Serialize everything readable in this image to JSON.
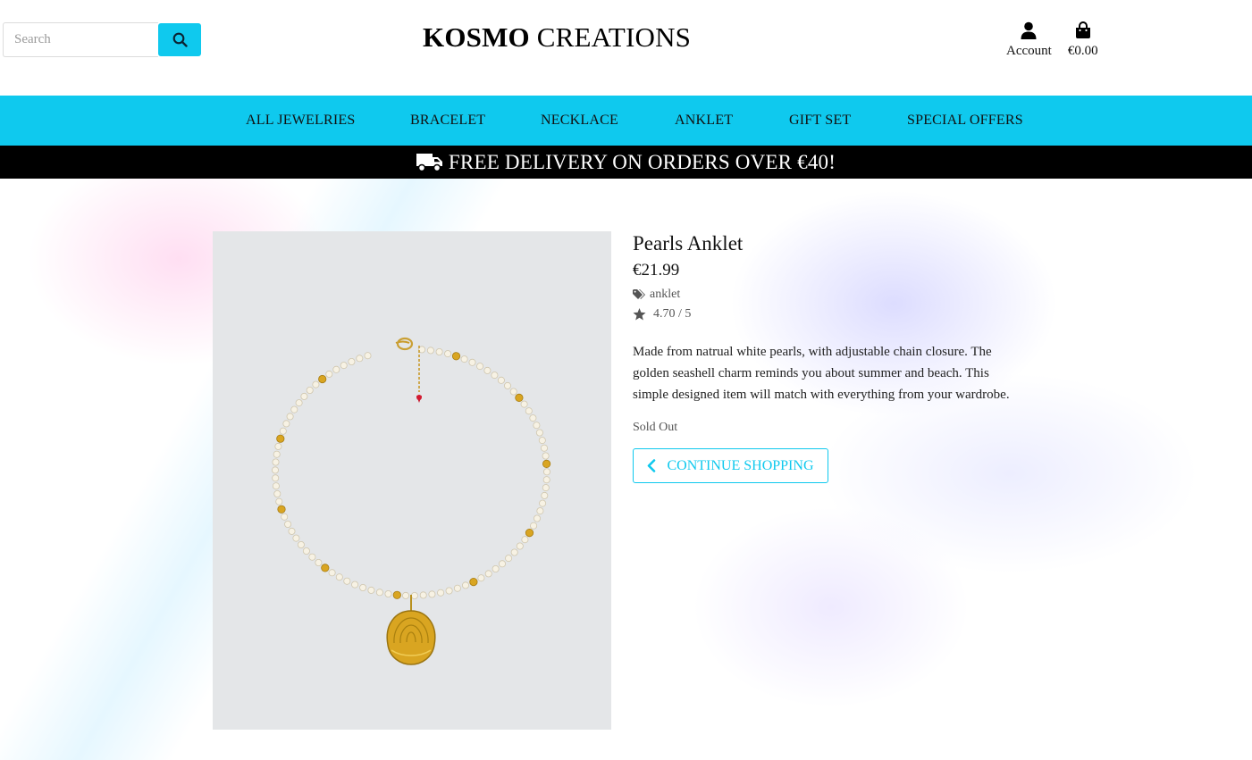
{
  "header": {
    "search_placeholder": "Search",
    "brand_bold": "KOSMO",
    "brand_rest": " CREATIONS",
    "account_label": "Account",
    "cart_total": "€0.00",
    "icons": {
      "search": "search-icon",
      "account": "user-icon",
      "cart": "shopping-bag-icon"
    }
  },
  "nav": {
    "items": [
      {
        "label": "ALL JEWELRIES"
      },
      {
        "label": "BRACELET"
      },
      {
        "label": "NECKLACE"
      },
      {
        "label": "ANKLET"
      },
      {
        "label": "GIFT SET"
      },
      {
        "label": "SPECIAL OFFERS"
      }
    ]
  },
  "banner": {
    "text": "FREE DELIVERY ON ORDERS OVER €40!",
    "icon": "truck-icon"
  },
  "product": {
    "name": "Pearls Anklet",
    "price": "€21.99",
    "category": "anklet",
    "rating": "4.70 / 5",
    "description": "Made from natrual white pearls, with adjustable chain closure. The golden seashell charm reminds you about summer and beach. This simple designed item will match with everything from your wardrobe.",
    "stock_status": "Sold Out",
    "continue_label": "CONTINUE SHOPPING"
  },
  "colors": {
    "accent": "#0fc9ee",
    "banner_bg": "#000000",
    "gold": "#d9a521"
  }
}
